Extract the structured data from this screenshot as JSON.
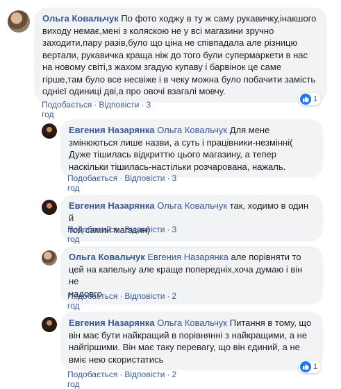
{
  "comments": [
    {
      "author": "Ольга Ковальчук",
      "mention": "",
      "text_lines": [
        "По фото ходжу в ту ж саму рукавичку,інакшого",
        "виходу немає,мені з коляскою не у всі магазини зручно",
        "заходити,пару разів,було що ціна не співпадала але різницю",
        "вертали, рукавичка краща ніж до того були супермаркети в нас",
        "на новому світі,з жахом згадую купаву і барвінок це саме",
        "гірше,там було все несвіже і в чеку можна було побачити замість",
        "однієї одиниці дві,а про овочі взагалі мовчу."
      ],
      "like_label": "Подобається",
      "reply_label": "Відповісти",
      "time": "3 год",
      "reactions_count": "1"
    },
    {
      "author": "Евгения Назарянка",
      "mention": "Ольга Ковальчук",
      "text_lines": [
        "Для мене",
        "змінюються лише назви, а суть і працівники-незмінні(",
        "Дуже тішилась відкриттю цього магазину, а тепер",
        "наскільки тішилась-настільки розчарована, нажаль."
      ],
      "like_label": "Подобається",
      "reply_label": "Відповісти",
      "time": "3 год",
      "reactions_count": ""
    },
    {
      "author": "Евгения Назарянка",
      "mention": "Ольга Ковальчук",
      "text_lines": [
        "так, ходимо в один й",
        "той самий магазин)"
      ],
      "like_label": "Подобається",
      "reply_label": "Відповісти",
      "time": "3 год",
      "reactions_count": ""
    },
    {
      "author": "Ольга Ковальчук",
      "mention": "Евгения Назарянка",
      "text_lines": [
        "але порівняти то",
        "цей на капельку але краще попередніх,хоча думаю і він не",
        "надовго"
      ],
      "like_label": "Подобається",
      "reply_label": "Відповісти",
      "time": "2 год",
      "reactions_count": ""
    },
    {
      "author": "Евгения Назарянка",
      "mention": "Ольга Ковальчук",
      "text_lines": [
        "Питання в тому, що",
        "він має бути найкращий в порівнянні з найкращими, а не",
        "найгіршими. Він має таку перевагу, що він єдиний, а не",
        "вміє нею скористатись"
      ],
      "like_label": "Подобається",
      "reply_label": "Відповісти",
      "time": "2 год",
      "reactions_count": "1"
    }
  ]
}
